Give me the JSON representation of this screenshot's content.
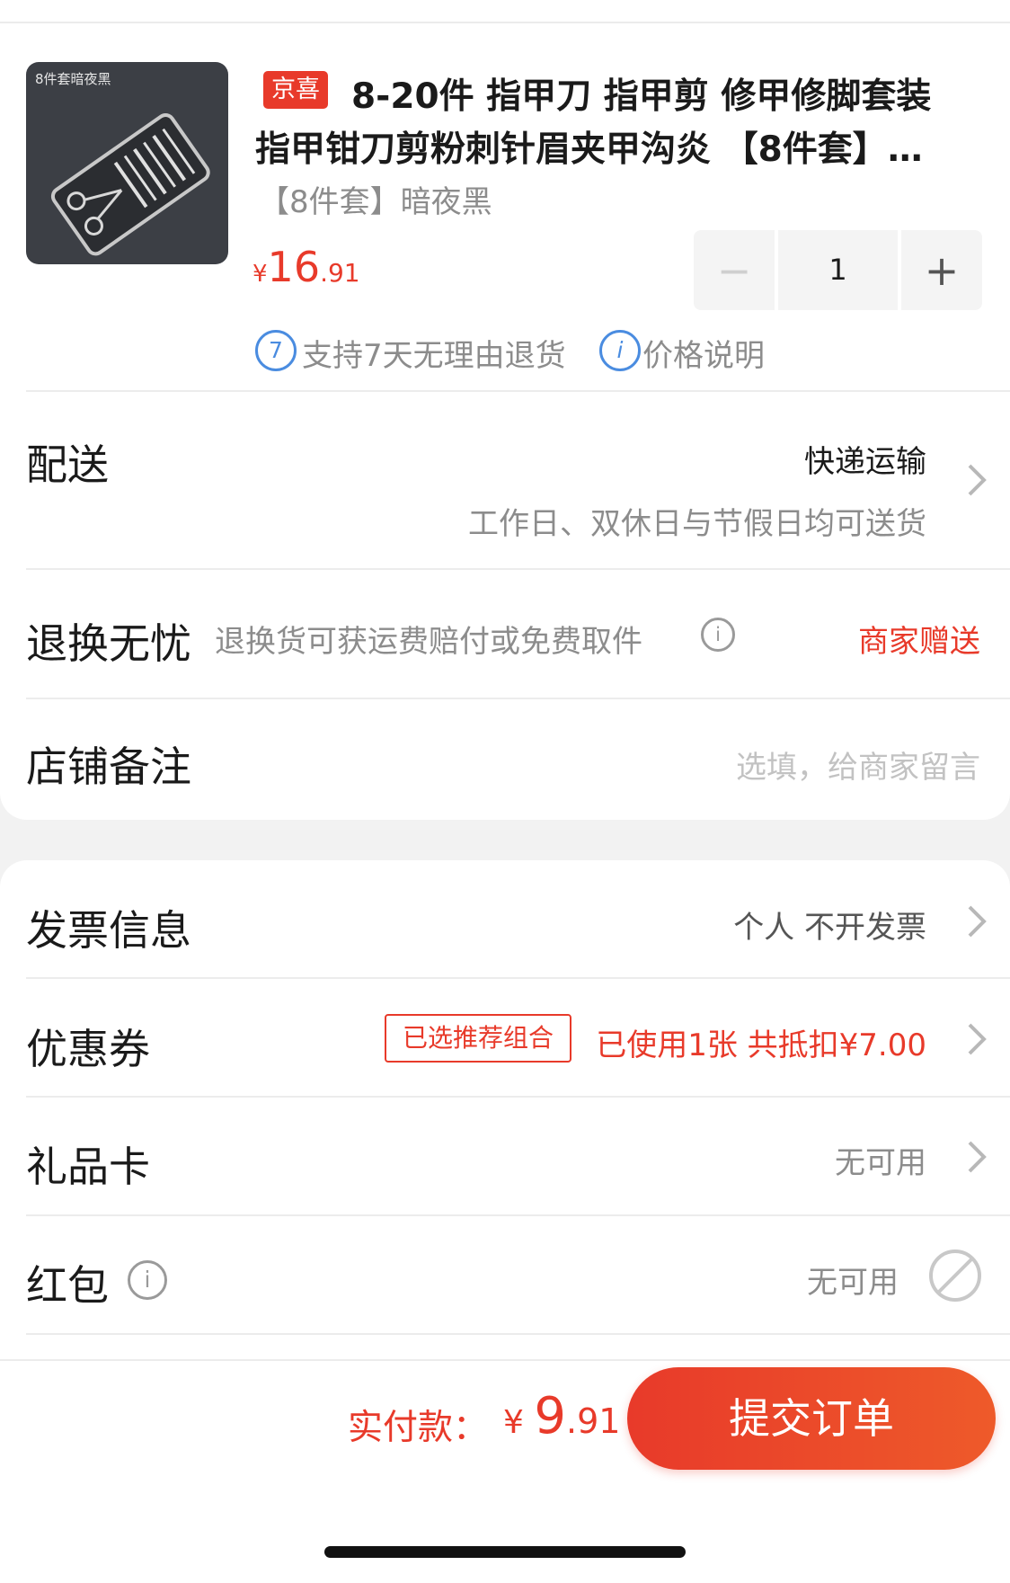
{
  "product": {
    "image_label": "8件套暗夜黑",
    "tag": "京喜",
    "title_line1": "8-20件 指甲刀 指甲剪 修甲修脚套装",
    "title_line2": "指甲钳刀剪粉刺针眉夹甲沟炎 【8件套】…",
    "spec": "【8件套】暗夜黑",
    "price_currency": "¥",
    "price_int": "16",
    "price_dec": ".91",
    "quantity": "1",
    "minus_symbol": "−",
    "plus_symbol": "+"
  },
  "services": [
    {
      "icon_text": "7",
      "icon": "seven-day-return-icon",
      "label": "支持7天无理由退货"
    },
    {
      "icon_text": "i",
      "icon": "info-icon",
      "label": "价格说明"
    }
  ],
  "delivery": {
    "label": "配送",
    "method": "快递运输",
    "note": "工作日、双休日与节假日均可送货"
  },
  "return_guarantee": {
    "label": "退换无忧",
    "desc": "退换货可获运费赔付或免费取件",
    "value": "商家赠送"
  },
  "store_note": {
    "label": "店铺备注",
    "placeholder": "选填，给商家留言"
  },
  "invoice": {
    "label": "发票信息",
    "value": "个人 不开发票"
  },
  "coupon": {
    "label": "优惠券",
    "tag": "已选推荐组合",
    "value": "已使用1张 共抵扣¥7.00"
  },
  "gift_card": {
    "label": "礼品卡",
    "value": "无可用"
  },
  "red_packet": {
    "label": "红包",
    "value": "无可用"
  },
  "footer": {
    "total_label": "实付款：",
    "total_currency": "¥ ",
    "total_int": "9",
    "total_dec": ".91",
    "submit": "提交订单"
  },
  "colors": {
    "accent": "#e83a2a",
    "blue": "#4a8ce0",
    "muted": "#8c8c8c"
  }
}
